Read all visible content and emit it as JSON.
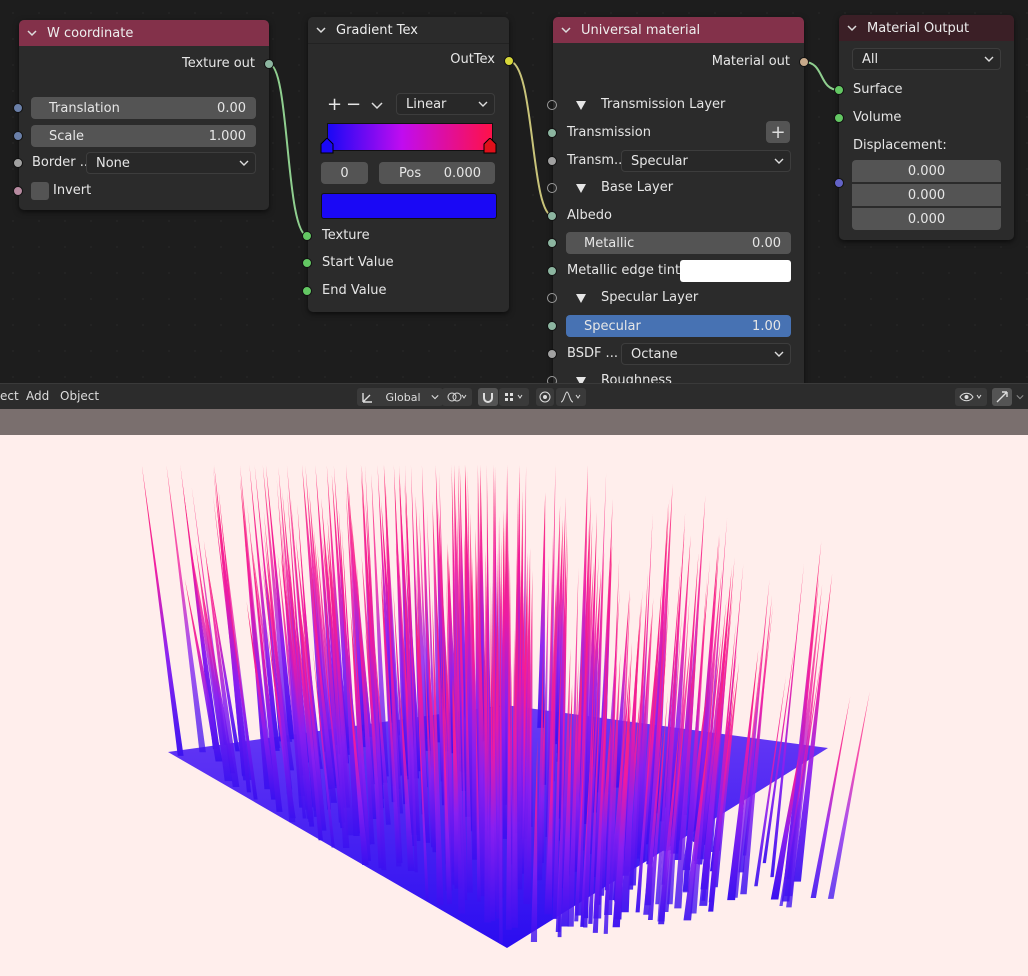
{
  "nodes": {
    "w_coordinate": {
      "title": "W coordinate",
      "output": "Texture out",
      "translation": {
        "label": "Translation",
        "value": "0.00"
      },
      "scale": {
        "label": "Scale",
        "value": "1.000"
      },
      "border": {
        "label": "Border ...",
        "value": "None"
      },
      "invert": {
        "label": "Invert"
      }
    },
    "gradient_tex": {
      "title": "Gradient Tex",
      "output": "OutTex",
      "interpolation": "Linear",
      "index": "0",
      "pos_label": "Pos",
      "pos_value": "0.000",
      "inputs": [
        "Texture",
        "Start Value",
        "End Value"
      ],
      "swatch_color": "#1a08f5"
    },
    "universal_material": {
      "title": "Universal material",
      "output": "Material out",
      "transmission_layer": "Transmission Layer",
      "transmission": "Transmission",
      "transmission_type_label": "Transm...",
      "transmission_type_value": "Specular",
      "base_layer": "Base Layer",
      "albedo": "Albedo",
      "metallic": {
        "label": "Metallic",
        "value": "0.00"
      },
      "metallic_edge_tint": "Metallic edge tint:",
      "specular_layer": "Specular Layer",
      "specular": {
        "label": "Specular",
        "value": "1.00"
      },
      "bsdf_label": "BSDF ...",
      "bsdf_value": "Octane",
      "roughness": "Roughness"
    },
    "material_output": {
      "title": "Material Output",
      "target": "All",
      "surface": "Surface",
      "volume": "Volume",
      "displacement": "Displacement:",
      "disp_values": [
        "0.000",
        "0.000",
        "0.000"
      ]
    }
  },
  "toolbar": {
    "menu_object_partial": "ect",
    "menu_add": "Add",
    "menu_object": "Object",
    "orientation": "Global"
  },
  "colors": {
    "node_red_header": "#83314a",
    "viewport_bg": "#ffeeec",
    "specular_field": "#4772b3",
    "gradient_start": "#1a08f5",
    "gradient_end": "#ff1149"
  }
}
